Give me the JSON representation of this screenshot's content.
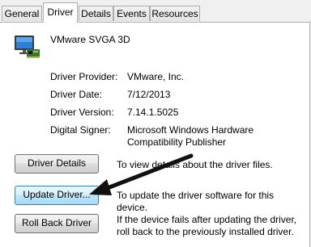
{
  "tabs": [
    {
      "label": "General",
      "active": false
    },
    {
      "label": "Driver",
      "active": true
    },
    {
      "label": "Details",
      "active": false
    },
    {
      "label": "Events",
      "active": false
    },
    {
      "label": "Resources",
      "active": false
    }
  ],
  "device": {
    "icon": "display-adapter-icon",
    "name": "VMware SVGA 3D"
  },
  "properties": [
    {
      "label": "Driver Provider:",
      "value": "VMware, Inc."
    },
    {
      "label": "Driver Date:",
      "value": "7/12/2013"
    },
    {
      "label": "Driver Version:",
      "value": "7.14.1.5025"
    },
    {
      "label": "Digital Signer:",
      "value": "Microsoft Windows Hardware Compatibility Publisher"
    }
  ],
  "actions": [
    {
      "label": "Driver Details",
      "description": "To view details about the driver files."
    },
    {
      "label": "Update Driver...",
      "description": "To update the driver software for this device."
    },
    {
      "label": "Roll Back Driver",
      "description": "If the device fails after updating the driver, roll back to the previously installed driver."
    }
  ],
  "colors": {
    "window_bg": "#f0f0f0",
    "panel_bg": "#ffffff",
    "tab_border": "#adadad",
    "arrow": "#111111"
  }
}
